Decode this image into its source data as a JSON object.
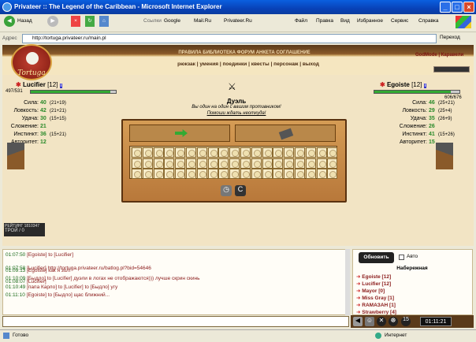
{
  "window": {
    "title": "Privateer :: The Legend of the Caribbean - Microsoft Internet Explorer"
  },
  "menu": [
    "Файл",
    "Правка",
    "Вид",
    "Избранное",
    "Сервис",
    "Справка"
  ],
  "toolbar": {
    "back": "Назад",
    "links": "Ссылки",
    "google": "Google",
    "mailru": "Mail.Ru",
    "privateer": "Privateer.Ru"
  },
  "address": {
    "label": "Адрес",
    "url": "http://tortuga.privateer.ru/main.pl",
    "go": "Переход"
  },
  "game": {
    "logo": "Tortuga",
    "nav_top": "ПРАВИЛА  БИБЛИОТЕКА  ФОРУМ  АНКЕТА  СОГЛАШЕНИЕ",
    "nav_main": "рюкзак | умения | поединки | квесты | персонаж | выход",
    "godmode": "GodMode",
    "karaveli": "Каравели",
    "player": {
      "name": "Lucifier",
      "level": "[12]",
      "hp": "497/531",
      "hp_fraction": 0.936,
      "stats": [
        [
          "Сила:",
          "40",
          "(21+19)"
        ],
        [
          "Ловкость:",
          "42",
          "(21+21)"
        ],
        [
          "Удача:",
          "30",
          "(15+15)"
        ],
        [
          "Сложение:",
          "21",
          ""
        ],
        [
          "Инстинкт:",
          "36",
          "(15+21)"
        ],
        [
          "Авторитет:",
          "12",
          ""
        ]
      ]
    },
    "enemy": {
      "name": "Egoiste",
      "level": "[12]",
      "hp": "606/676",
      "hp_fraction": 0.896,
      "stats": [
        [
          "Сила:",
          "46",
          "(25+21)"
        ],
        [
          "Ловкость:",
          "29",
          "(25+4)"
        ],
        [
          "Удача:",
          "35",
          "(26+9)"
        ],
        [
          "Сложение:",
          "26",
          ""
        ],
        [
          "Инстинкт:",
          "41",
          "(15+26)"
        ],
        [
          "Авторитет:",
          "15",
          ""
        ]
      ]
    },
    "duel": {
      "title": "Дуэль",
      "line1": "Вы один на один с вашим противником!",
      "line2": "Помоши ждать неоткуда!"
    },
    "rating": {
      "label": "РЕЙТИНГ",
      "value": "1810347",
      "label2": "ТРОЙ",
      "value2": "/ 0"
    }
  },
  "chat": [
    {
      "ts": "01:07:50",
      "text": "[Egoiste] to [Lucifier]"
    },
    {
      "ts": "01:07:58",
      "text": "[Lucifier] http://tortuga.privateer.ru/batlog.pl?bid=54646"
    },
    {
      "ts": "01:08:07",
      "text": "[Lucifier]"
    },
    {
      "ts": "01:09:13",
      "text": "[Egoiste] как я зол!"
    },
    {
      "ts": "01:10:09",
      "text": "[Быдло] to [Lucifier] дуэли в логах не отображаются))) лучше скрин скинь"
    },
    {
      "ts": "01:10:49",
      "text": "[папа Карло] to [Lucifier] to [Быдло] угу"
    },
    {
      "ts": "01:11:10",
      "text": "[Egoiste] to [Быдло] щас ближний..."
    }
  ],
  "online": {
    "refresh": "Обновить",
    "auto": "Авто",
    "location": "Набережная",
    "users": [
      "Egoiste [12]",
      "Lucifier [12]",
      "Mayor [0]",
      "Miss Gray [1]",
      "RAMAЗАН [1]",
      "Strawberry [4]"
    ]
  },
  "clock": "01:11:21",
  "counter": "15",
  "status": {
    "done": "Готово",
    "zone": "Интернет"
  },
  "colors": {
    "accent": "#0a5fe0",
    "board": "#c88a45"
  }
}
